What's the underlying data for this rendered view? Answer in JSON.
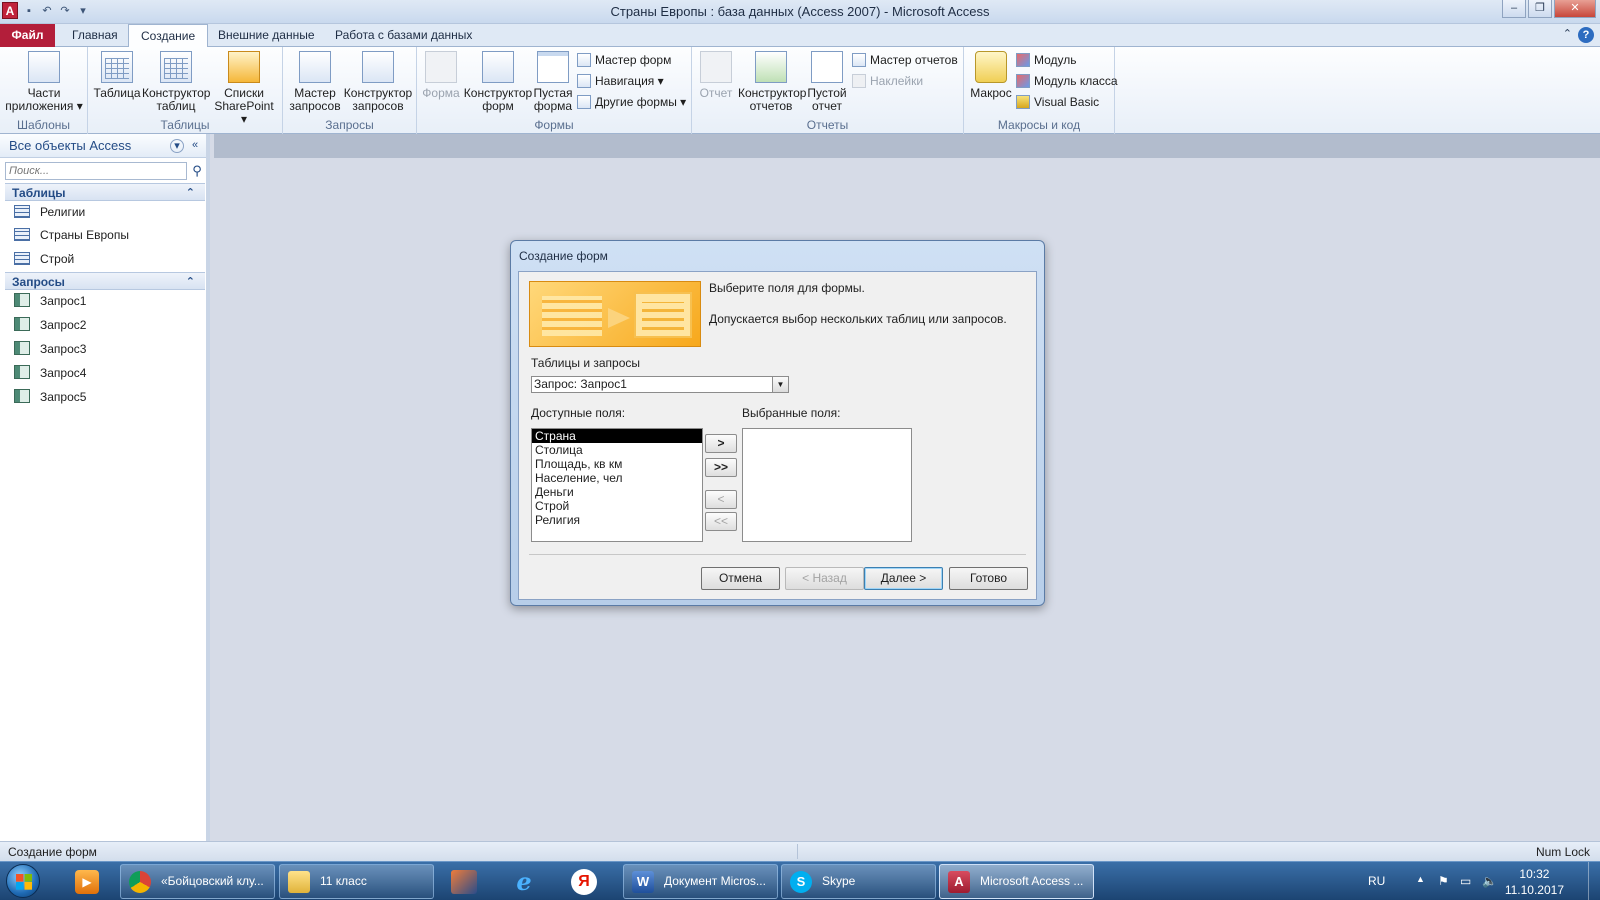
{
  "window": {
    "title": "Страны Европы : база данных (Access 2007)  -  Microsoft Access",
    "app_icon": "A"
  },
  "ribbon_tabs": [
    "Файл",
    "Главная",
    "Создание",
    "Внешние данные",
    "Работа с базами данных"
  ],
  "active_tab": "Создание",
  "ribbon": {
    "templates": {
      "label": "Шаблоны",
      "parts": "Части\nприложения ▾"
    },
    "tables": {
      "label": "Таблицы",
      "table": "Таблица",
      "table_designer": "Конструктор\nтаблиц",
      "sharepoint": "Списки\nSharePoint ▾"
    },
    "queries": {
      "label": "Запросы",
      "query_wizard": "Мастер\nзапросов",
      "query_designer": "Конструктор\nзапросов"
    },
    "forms": {
      "label": "Формы",
      "form": "Форма",
      "form_designer": "Конструктор\nформ",
      "blank_form": "Пустая\nформа",
      "form_wizard": "Мастер форм",
      "navigation": "Навигация ▾",
      "other_forms": "Другие формы ▾"
    },
    "reports": {
      "label": "Отчеты",
      "report": "Отчет",
      "report_designer": "Конструктор\nотчетов",
      "blank_report": "Пустой\nотчет",
      "report_wizard": "Мастер отчетов",
      "labels": "Наклейки"
    },
    "macros": {
      "label": "Макросы и код",
      "macro": "Макрос",
      "module": "Модуль",
      "class_module": "Модуль класса",
      "vba": "Visual Basic"
    }
  },
  "navpane": {
    "header": "Все объекты Access",
    "search_placeholder": "Поиск...",
    "tables_group": "Таблицы",
    "tables": [
      "Религии",
      "Страны Европы",
      "Строй"
    ],
    "queries_group": "Запросы",
    "queries": [
      "Запрос1",
      "Запрос2",
      "Запрос3",
      "Запрос4",
      "Запрос5"
    ]
  },
  "dialog": {
    "title": "Создание форм",
    "instruction": "Выберите поля для формы.",
    "note": "Допускается выбор нескольких таблиц или запросов.",
    "source_label": "Таблицы и запросы",
    "source_value": "Запрос: Запрос1",
    "available_label": "Доступные поля:",
    "selected_label": "Выбранные поля:",
    "available_fields": [
      "Страна",
      "Столица",
      "Площадь, кв км",
      "Население, чел",
      "Деньги",
      "Строй",
      "Религия"
    ],
    "selected_fields": [],
    "move_buttons": [
      ">",
      ">>",
      "<",
      "<<"
    ],
    "buttons": {
      "cancel": "Отмена",
      "back": "< Назад",
      "next": "Далее >",
      "finish": "Готово"
    }
  },
  "statusbar": {
    "left": "Создание форм",
    "right": "Num Lock"
  },
  "taskbar": {
    "items": [
      "«Бойцовский клу...",
      "11 класс",
      "Документ Micros...",
      "Skype",
      "Microsoft Access ..."
    ],
    "lang": "RU",
    "time": "10:32",
    "date": "11.10.2017"
  }
}
